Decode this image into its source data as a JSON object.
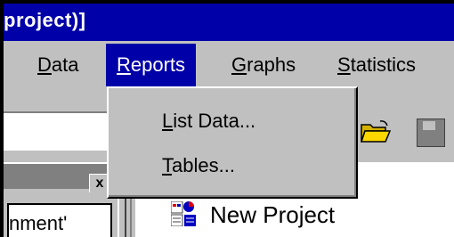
{
  "window": {
    "title": "project)]"
  },
  "menubar": {
    "items": [
      {
        "label": "Data",
        "mnemonic": "D",
        "rest": "ata"
      },
      {
        "label": "Reports",
        "mnemonic": "R",
        "rest": "eports",
        "active": true
      },
      {
        "label": "Graphs",
        "mnemonic": "G",
        "rest": "raphs"
      },
      {
        "label": "Statistics",
        "mnemonic": "S",
        "rest": "tatistics"
      }
    ]
  },
  "reports_menu": {
    "items": [
      {
        "label": "List Data...",
        "mnemonic": "L",
        "rest": "ist Data..."
      },
      {
        "label": "Tables...",
        "mnemonic": "T",
        "rest": "ables..."
      }
    ]
  },
  "left_panel": {
    "close_glyph": "x",
    "tab_label": "nment'"
  },
  "tree": {
    "root_label": "New Project"
  },
  "icons": {
    "open": "folder-open-icon",
    "save": "save-disk-icon",
    "project": "project-icon"
  },
  "colors": {
    "titlebar": "#0000a8",
    "chrome": "#c0c0c0",
    "highlight": "#0000a8"
  }
}
